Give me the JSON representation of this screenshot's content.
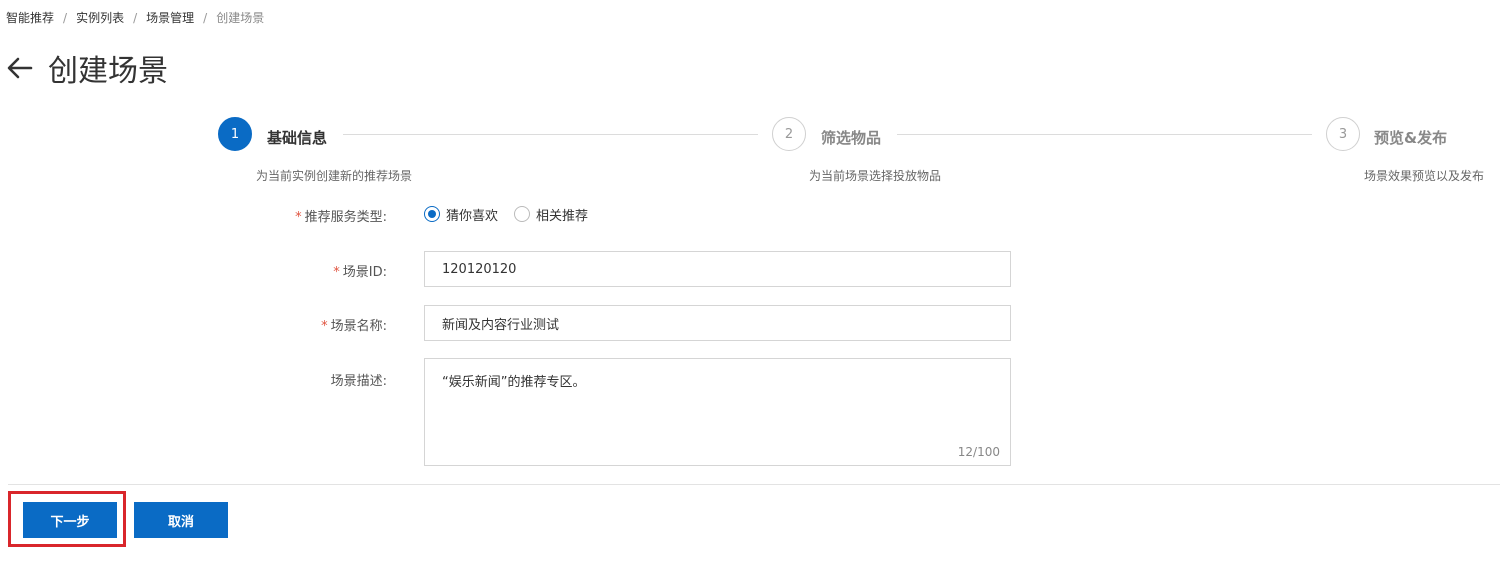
{
  "breadcrumb": {
    "items": [
      "智能推荐",
      "实例列表",
      "场景管理"
    ],
    "current": "创建场景"
  },
  "page": {
    "title": "创建场景"
  },
  "steps": [
    {
      "number": "1",
      "title": "基础信息",
      "desc": "为当前实例创建新的推荐场景",
      "status": "active"
    },
    {
      "number": "2",
      "title": "筛选物品",
      "desc": "为当前场景选择投放物品",
      "status": "inactive"
    },
    {
      "number": "3",
      "title": "预览&发布",
      "desc": "场景效果预览以及发布",
      "status": "inactive"
    }
  ],
  "form": {
    "service_type": {
      "label": "推荐服务类型:",
      "options": [
        "猜你喜欢",
        "相关推荐"
      ],
      "selected": "猜你喜欢"
    },
    "scene_id": {
      "label": "场景ID:",
      "value": "120120120"
    },
    "scene_name": {
      "label": "场景名称:",
      "value": "新闻及内容行业测试"
    },
    "scene_desc": {
      "label": "场景描述:",
      "value": "“娱乐新闻”的推荐专区。",
      "count": "12/100"
    },
    "required_mark": "*"
  },
  "buttons": {
    "next": "下一步",
    "cancel": "取消"
  },
  "colors": {
    "primary": "#0a6bc5",
    "required": "#e0533f",
    "highlight": "#d9262b"
  }
}
